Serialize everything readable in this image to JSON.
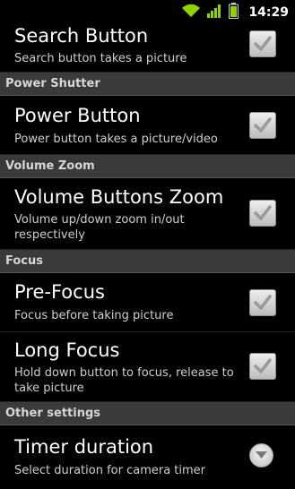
{
  "status_bar": {
    "time": "14:29",
    "icons": [
      "wifi-icon",
      "signal-icon",
      "battery-icon"
    ]
  },
  "prefs": {
    "search_button": {
      "title": "Search Button",
      "summary": "Search button takes a picture",
      "checked": true
    },
    "power_header": "Power Shutter",
    "power_button": {
      "title": "Power Button",
      "summary": "Power button takes a picture/video",
      "checked": true
    },
    "volume_header": "Volume Zoom",
    "volume_zoom": {
      "title": "Volume Buttons Zoom",
      "summary": "Volume up/down zoom in/out respectively",
      "checked": true
    },
    "focus_header": "Focus",
    "pre_focus": {
      "title": "Pre-Focus",
      "summary": "Focus before taking picture",
      "checked": true
    },
    "long_focus": {
      "title": "Long Focus",
      "summary": "Hold down button to focus, release to take picture",
      "checked": true
    },
    "other_header": "Other settings",
    "timer": {
      "title": "Timer duration",
      "summary": "Select duration for camera timer"
    }
  },
  "colors": {
    "accent_green": "#8fd400",
    "checkbox_fill": "#d9d9d9",
    "category_bg": "#3a3a3a"
  }
}
